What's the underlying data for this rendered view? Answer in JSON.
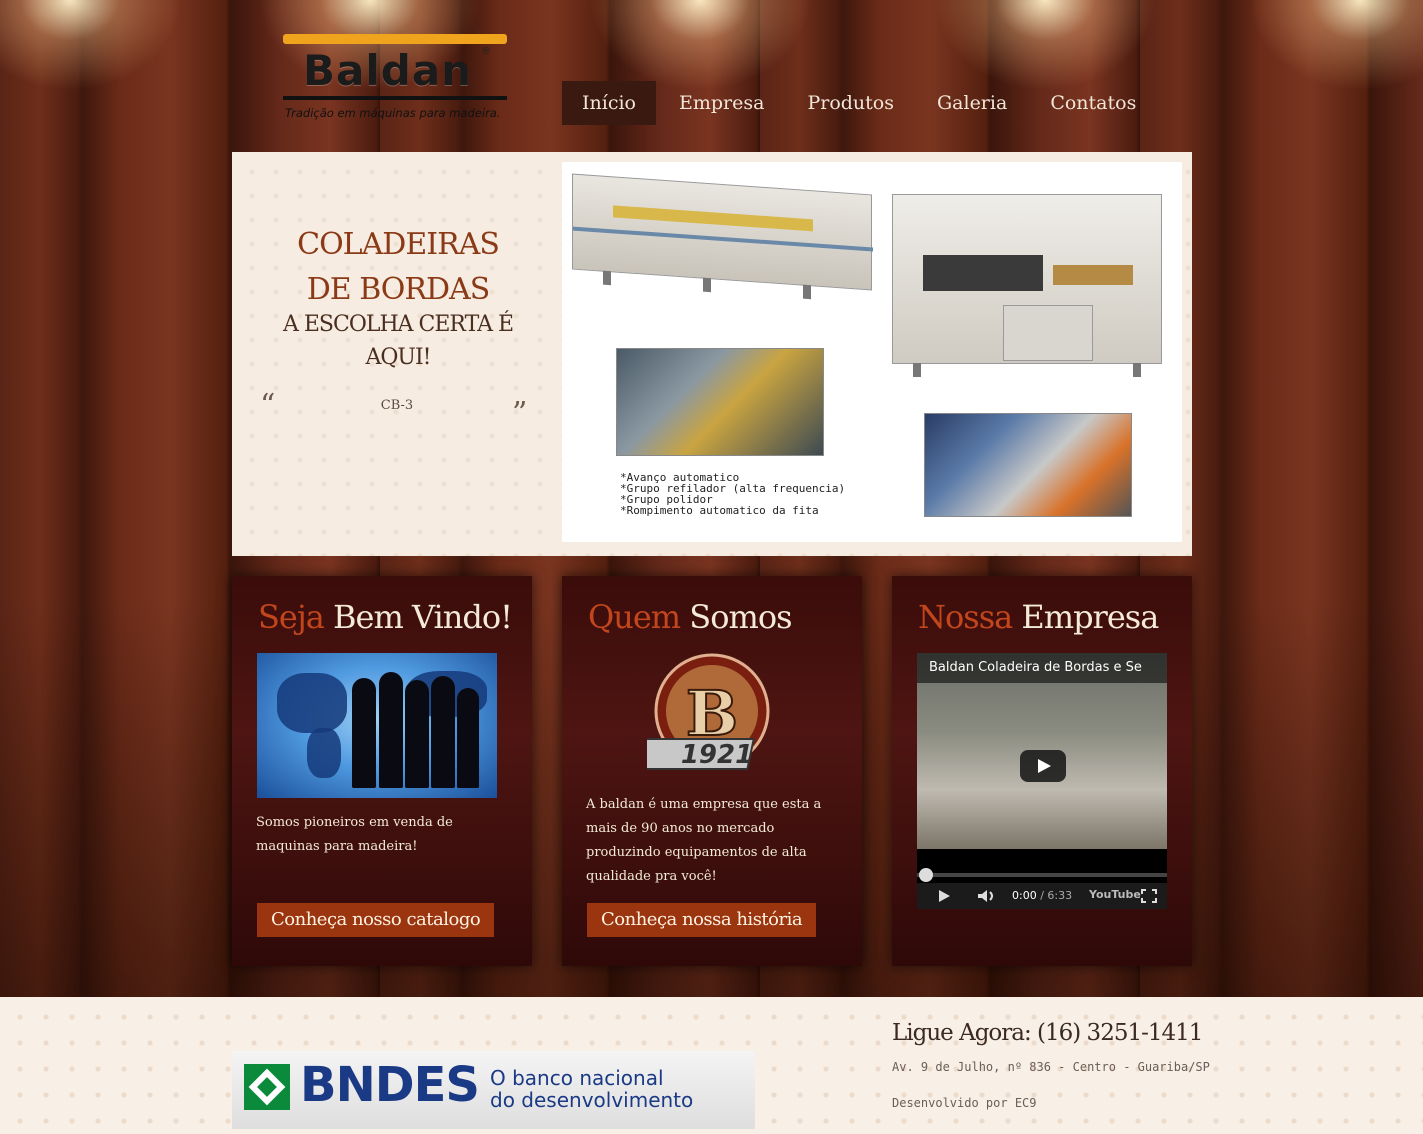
{
  "header": {
    "logo_name": "Baldan",
    "logo_registered": "®",
    "logo_tagline": "Tradição em máquinas para madeira.",
    "nav": [
      {
        "label": "Início",
        "active": true
      },
      {
        "label": "Empresa",
        "active": false
      },
      {
        "label": "Produtos",
        "active": false
      },
      {
        "label": "Galeria",
        "active": false
      },
      {
        "label": "Contatos",
        "active": false
      }
    ]
  },
  "slider": {
    "title": "COLADEIRAS DE BORDAS",
    "subtitle": "A ESCOLHA CERTA É AQUI!",
    "quote_open": "“",
    "quote_close": "”",
    "model": "CB-3",
    "features": [
      "*Avanço automatico",
      "*Grupo refilador (alta frequencia)",
      "*Grupo polidor",
      "*Rompimento automatico da fita"
    ]
  },
  "boxes": [
    {
      "title_accent": "Seja",
      "title_rest": " Bem Vindo!",
      "text": "Somos pioneiros em venda de maquinas para madeira!",
      "button": "Conheça nosso catalogo"
    },
    {
      "title_accent": "Quem",
      "title_rest": " Somos",
      "badge_year": "1921",
      "text": "A baldan é uma empresa que esta a mais de 90 anos no mercado produzindo equipamentos de alta qualidade pra você!",
      "button": "Conheça nossa história"
    },
    {
      "title_accent": "Nossa",
      "title_rest": " Empresa",
      "video_title": "Baldan Coladeira de Bordas e Se",
      "video_time": "0:00",
      "video_duration": " / 6:33",
      "video_brand": "YouTube"
    }
  ],
  "footer": {
    "bndes_brand": "BNDES",
    "bndes_slogan_1": "O banco nacional",
    "bndes_slogan_2": "do desenvolvimento",
    "call": "Ligue Agora: (16) 3251-1411",
    "address": "Av. 9 de Julho, nº 836 - Centro - Guariba/SP",
    "developer": "Desenvolvido por EC9"
  },
  "colors": {
    "accent": "#c2461c",
    "button": "#9a3510",
    "nav_active": "#3a1a10",
    "title": "#8a3a16"
  }
}
